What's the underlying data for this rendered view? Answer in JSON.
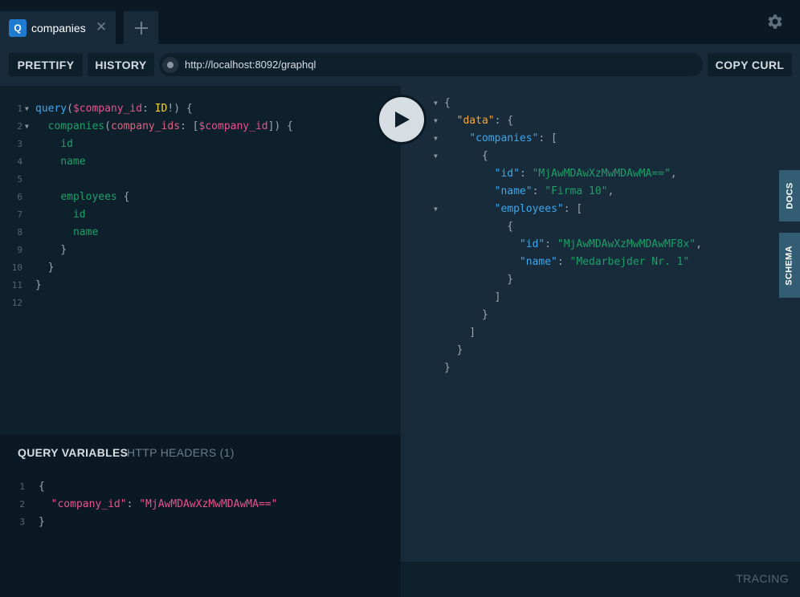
{
  "tabs": [
    {
      "badge": "Q",
      "label": "companies",
      "close": "✕"
    }
  ],
  "add_tab": "+",
  "toolbar": {
    "prettify_label": "PRETTIFY",
    "history_label": "HISTORY",
    "url": "http://localhost:8092/graphql",
    "copy_curl_label": "COPY CURL"
  },
  "query_lines": [
    {
      "n": "1",
      "fold": true,
      "tokens": [
        [
          "kw",
          "query"
        ],
        [
          "punc",
          "("
        ],
        [
          "var",
          "$company_id"
        ],
        [
          "punc",
          ": "
        ],
        [
          "type",
          "ID"
        ],
        [
          "punc",
          "!) {"
        ]
      ]
    },
    {
      "n": "2",
      "fold": true,
      "tokens": [
        [
          "punc",
          "  "
        ],
        [
          "field",
          "companies"
        ],
        [
          "punc",
          "("
        ],
        [
          "def",
          "company_ids"
        ],
        [
          "punc",
          ": ["
        ],
        [
          "var",
          "$company_id"
        ],
        [
          "punc",
          "]) {"
        ]
      ]
    },
    {
      "n": "3",
      "fold": false,
      "tokens": [
        [
          "punc",
          "    "
        ],
        [
          "field",
          "id"
        ]
      ]
    },
    {
      "n": "4",
      "fold": false,
      "tokens": [
        [
          "punc",
          "    "
        ],
        [
          "field",
          "name"
        ]
      ]
    },
    {
      "n": "5",
      "fold": false,
      "tokens": []
    },
    {
      "n": "6",
      "fold": false,
      "tokens": [
        [
          "punc",
          "    "
        ],
        [
          "field",
          "employees"
        ],
        [
          "punc",
          " {"
        ]
      ]
    },
    {
      "n": "7",
      "fold": false,
      "tokens": [
        [
          "punc",
          "      "
        ],
        [
          "field",
          "id"
        ]
      ]
    },
    {
      "n": "8",
      "fold": false,
      "tokens": [
        [
          "punc",
          "      "
        ],
        [
          "field",
          "name"
        ]
      ]
    },
    {
      "n": "9",
      "fold": false,
      "tokens": [
        [
          "punc",
          "    }"
        ]
      ]
    },
    {
      "n": "10",
      "fold": false,
      "tokens": [
        [
          "punc",
          "  }"
        ]
      ]
    },
    {
      "n": "11",
      "fold": false,
      "tokens": [
        [
          "punc",
          "}"
        ]
      ]
    },
    {
      "n": "12",
      "fold": false,
      "tokens": []
    }
  ],
  "variables": {
    "active_tab": "QUERY VARIABLES",
    "other_tab": "HTTP HEADERS (1)",
    "lines": [
      {
        "n": "1",
        "tokens": [
          [
            "punc",
            "{"
          ]
        ]
      },
      {
        "n": "2",
        "tokens": [
          [
            "punc",
            "  "
          ],
          [
            "key",
            "\"company_id\""
          ],
          [
            "punc",
            ": "
          ],
          [
            "str",
            "\"MjAwMDAwXzMwMDAwMA==\""
          ]
        ]
      },
      {
        "n": "3",
        "tokens": [
          [
            "punc",
            "}"
          ]
        ]
      }
    ]
  },
  "result_lines": [
    {
      "fold": true,
      "tokens": [
        [
          "punc",
          "{"
        ]
      ]
    },
    {
      "fold": true,
      "tokens": [
        [
          "punc",
          "  "
        ],
        [
          "keytop",
          "\"data\""
        ],
        [
          "punc",
          ": {"
        ]
      ]
    },
    {
      "fold": true,
      "tokens": [
        [
          "punc",
          "    "
        ],
        [
          "key",
          "\"companies\""
        ],
        [
          "punc",
          ": ["
        ]
      ]
    },
    {
      "fold": true,
      "tokens": [
        [
          "punc",
          "      {"
        ]
      ]
    },
    {
      "fold": false,
      "tokens": [
        [
          "punc",
          "        "
        ],
        [
          "key",
          "\"id\""
        ],
        [
          "punc",
          ": "
        ],
        [
          "str",
          "\"MjAwMDAwXzMwMDAwMA==\""
        ],
        [
          "punc",
          ","
        ]
      ]
    },
    {
      "fold": false,
      "tokens": [
        [
          "punc",
          "        "
        ],
        [
          "key",
          "\"name\""
        ],
        [
          "punc",
          ": "
        ],
        [
          "str",
          "\"Firma 10\""
        ],
        [
          "punc",
          ","
        ]
      ]
    },
    {
      "fold": true,
      "tokens": [
        [
          "punc",
          "        "
        ],
        [
          "key",
          "\"employees\""
        ],
        [
          "punc",
          ": ["
        ]
      ]
    },
    {
      "fold": false,
      "tokens": [
        [
          "punc",
          "          {"
        ]
      ]
    },
    {
      "fold": false,
      "tokens": [
        [
          "punc",
          "            "
        ],
        [
          "key",
          "\"id\""
        ],
        [
          "punc",
          ": "
        ],
        [
          "str",
          "\"MjAwMDAwXzMwMDAwMF8x\""
        ],
        [
          "punc",
          ","
        ]
      ]
    },
    {
      "fold": false,
      "tokens": [
        [
          "punc",
          "            "
        ],
        [
          "key",
          "\"name\""
        ],
        [
          "punc",
          ": "
        ],
        [
          "str",
          "\"Medarbejder Nr. 1\""
        ]
      ]
    },
    {
      "fold": false,
      "tokens": [
        [
          "punc",
          "          }"
        ]
      ]
    },
    {
      "fold": false,
      "tokens": [
        [
          "punc",
          "        ]"
        ]
      ]
    },
    {
      "fold": false,
      "tokens": [
        [
          "punc",
          "      }"
        ]
      ]
    },
    {
      "fold": false,
      "tokens": [
        [
          "punc",
          "    ]"
        ]
      ]
    },
    {
      "fold": false,
      "tokens": [
        [
          "punc",
          "  }"
        ]
      ]
    },
    {
      "fold": false,
      "tokens": [
        [
          "punc",
          "}"
        ]
      ]
    }
  ],
  "side_tabs": {
    "docs": "DOCS",
    "schema": "SCHEMA"
  },
  "footer": {
    "tracing": "TRACING"
  },
  "icons": {
    "run": "play-icon",
    "settings": "gear-icon"
  }
}
